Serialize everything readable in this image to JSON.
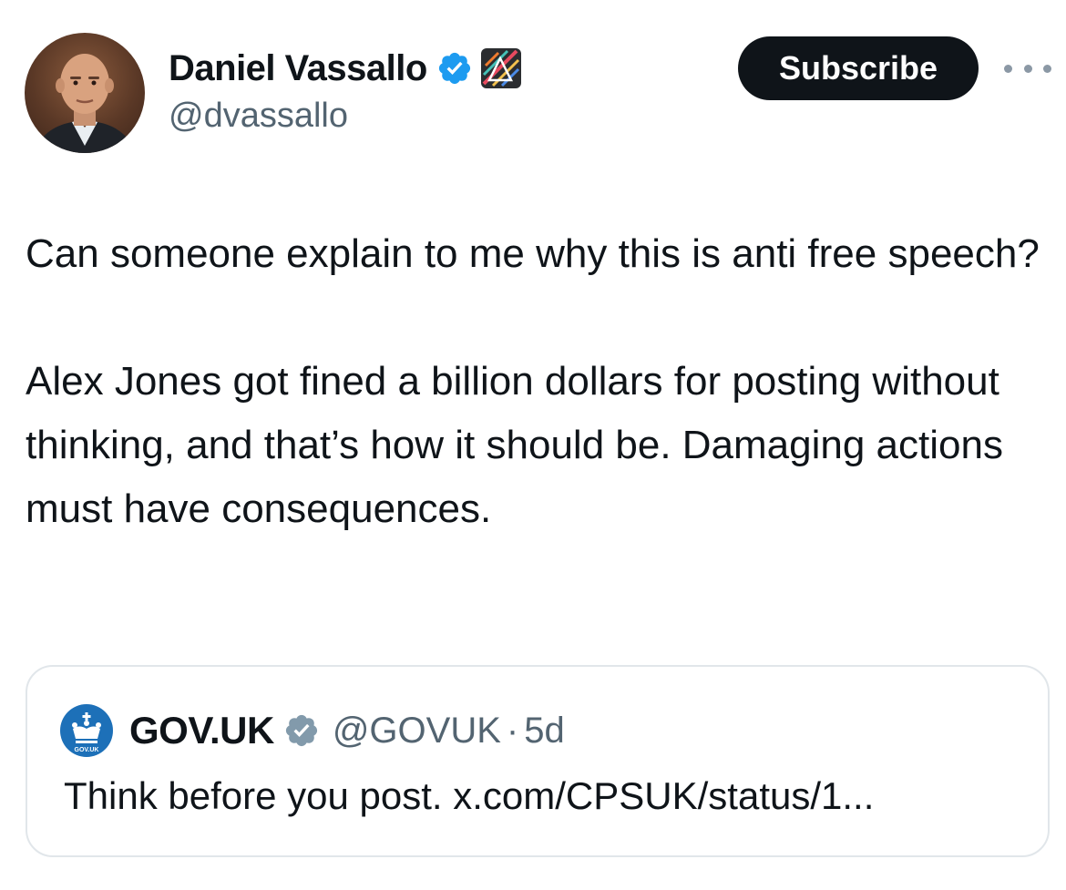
{
  "author": {
    "display_name": "Daniel Vassallo",
    "handle": "@dvassallo",
    "verified": true,
    "avatar_icon": "profile-photo"
  },
  "actions": {
    "subscribe_label": "Subscribe",
    "more_icon": "more-horizontal-icon"
  },
  "tweet": {
    "paragraphs": [
      "Can someone explain to me why this is anti free speech?",
      "Alex Jones got fined a billion dollars for posting without thinking, and that’s how it should be. Damaging actions must have consequences."
    ]
  },
  "quoted": {
    "display_name": "GOV.UK",
    "handle": "@GOVUK",
    "separator": "·",
    "time": "5d",
    "text": "Think before you post. x.com/CPSUK/status/1...",
    "avatar_label": "GOV.UK",
    "verified_color": "#829aab"
  },
  "colors": {
    "verified_blue": "#1d9bf0",
    "text_primary": "#0f1419",
    "text_secondary": "#536471",
    "govuk_blue": "#1d70b8"
  }
}
